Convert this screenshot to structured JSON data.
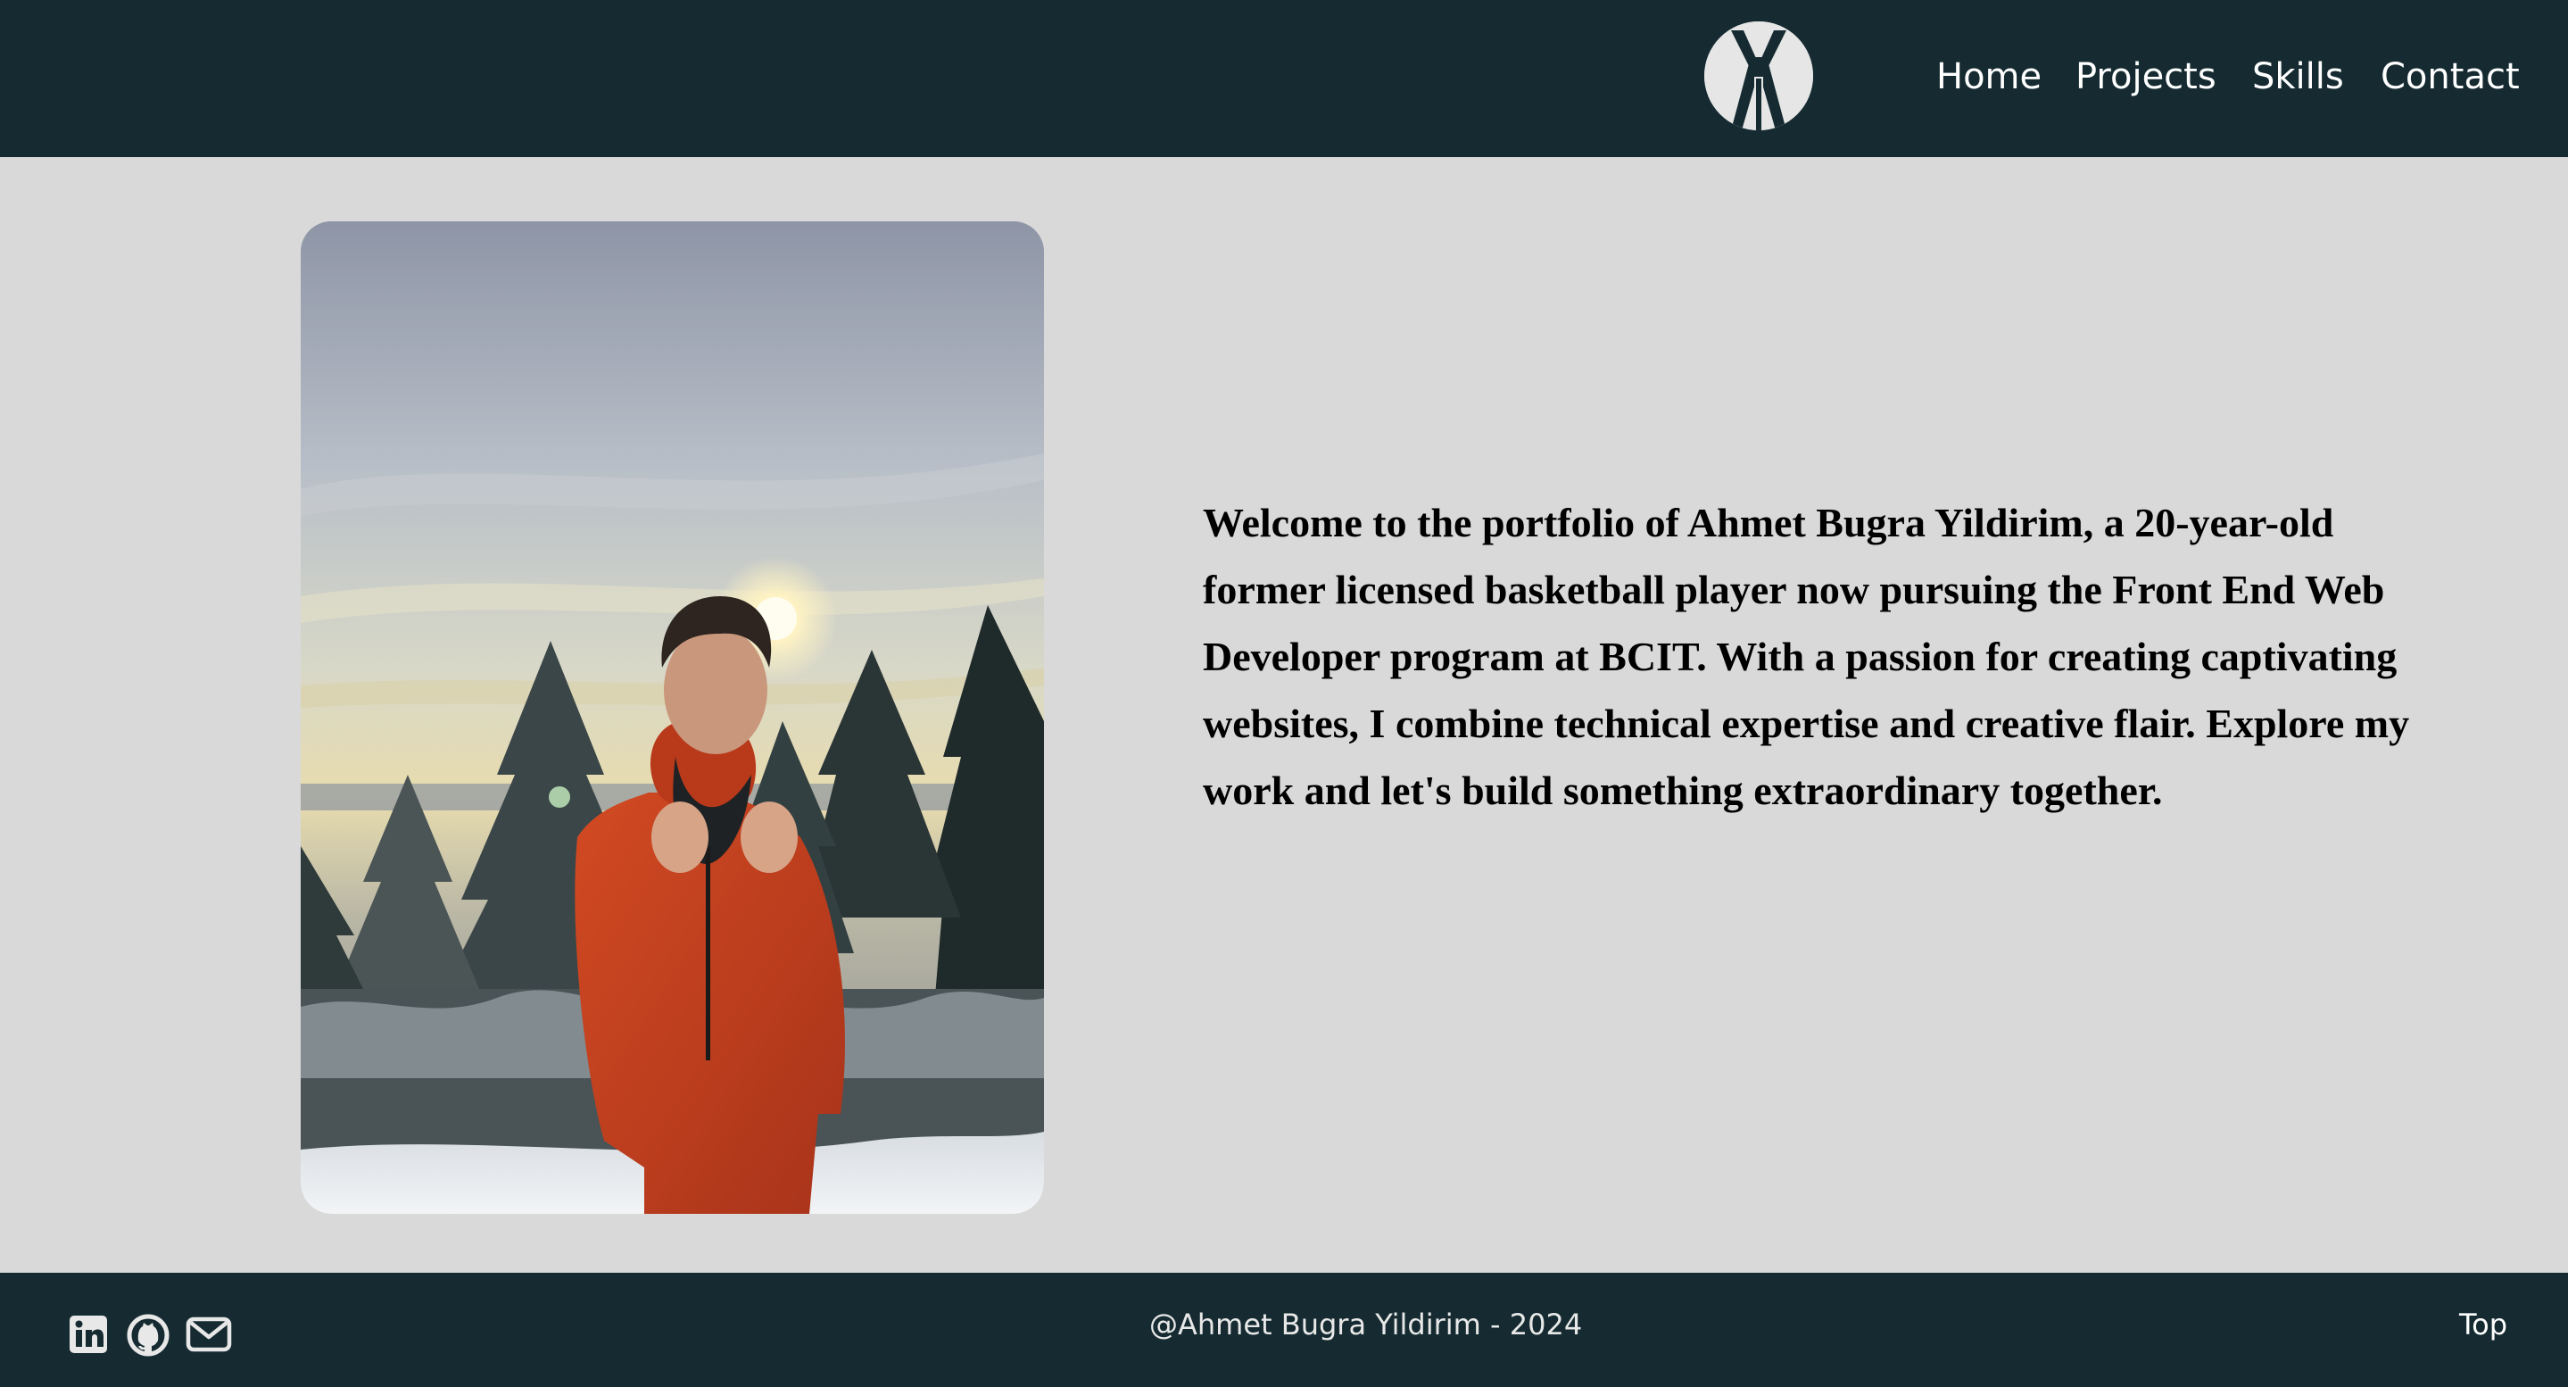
{
  "header": {
    "logo_icon": "ay-monogram-logo-icon",
    "nav": [
      {
        "label": "Home"
      },
      {
        "label": "Projects"
      },
      {
        "label": "Skills"
      },
      {
        "label": "Contact"
      }
    ]
  },
  "hero": {
    "photo_alt": "Portrait of Ahmet Bugra Yildirim in a snowy forest at sunset",
    "intro_text": "Welcome to the portfolio of Ahmet Bugra Yildirim, a 20-year-old former licensed basketball player now pursuing the Front End Web Developer program at BCIT. With a passion for creating captivating websites, I combine technical expertise and creative flair. Explore my work and let's build something extraordinary together."
  },
  "footer": {
    "social_icons": [
      "linkedin-icon",
      "github-icon",
      "mail-icon"
    ],
    "copyright": "@Ahmet Bugra Yildirim - 2024",
    "top_label": "Top"
  },
  "colors": {
    "header_bg": "#152b31",
    "page_bg": "#d9d9d9",
    "jacket": "#c8411c"
  }
}
